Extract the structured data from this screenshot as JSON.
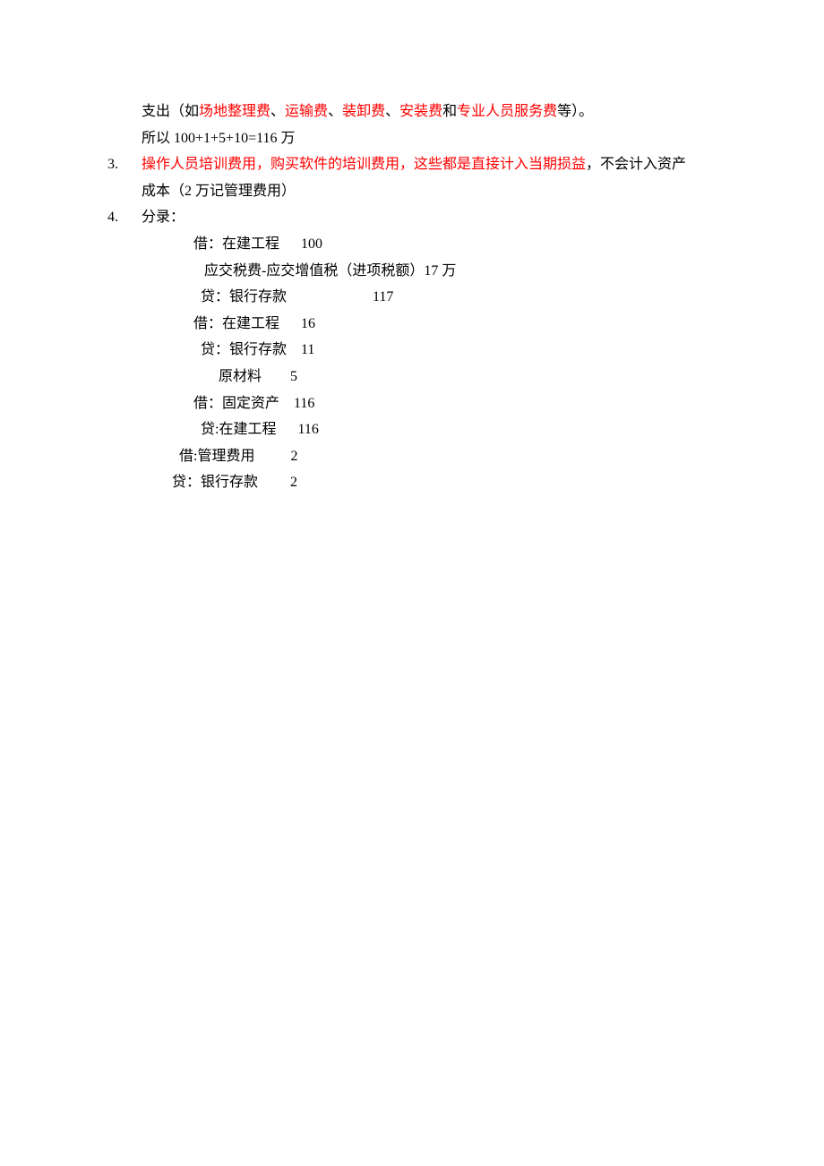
{
  "para1": {
    "pre": "支出（如",
    "r1": "场地整理费",
    "s1": "、",
    "r2": "运输费",
    "s2": "、",
    "r3": "装卸费",
    "s3": "、",
    "r4": "安装费",
    "s4": "和",
    "r5": "专业人员服务费",
    "post": "等）。"
  },
  "calc": "所以 100+1+5+10=116 万",
  "item3": {
    "num": "3.",
    "r1": "操作人员培训费用，购买软件的培训费用，这些都是直接计入当期损益",
    "post": "，不会计入资产",
    "line2": "成本（2 万记管理费用）"
  },
  "item4": {
    "num": "4.",
    "label": "分录："
  },
  "entries": {
    "e1": "借：在建工程      100",
    "e2": "   应交税费-应交增值税（进项税额）17 万",
    "e3": "  贷：银行存款                        117",
    "e4": "借：在建工程      16",
    "e5": "  贷：银行存款    11",
    "e6": "       原材料        5",
    "e7": "借：固定资产    116",
    "e8": "  贷:在建工程      116",
    "e9": "借:管理费用          2",
    "e10": "贷：银行存款         2"
  }
}
